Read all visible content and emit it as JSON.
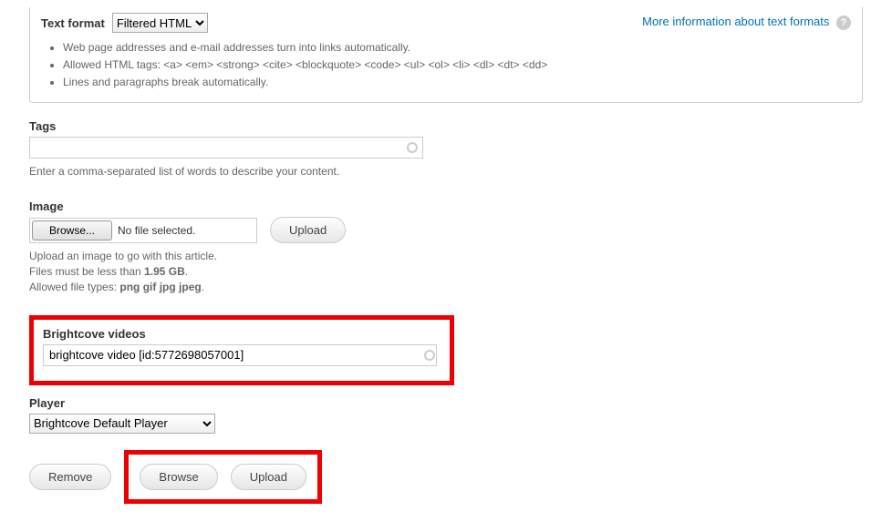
{
  "format": {
    "label": "Text format",
    "selected": "Filtered HTML",
    "more_info_label": "More information about text formats",
    "tips": [
      "Web page addresses and e-mail addresses turn into links automatically.",
      "Allowed HTML tags: <a> <em> <strong> <cite> <blockquote> <code> <ul> <ol> <li> <dl> <dt> <dd>",
      "Lines and paragraphs break automatically."
    ]
  },
  "tags": {
    "label": "Tags",
    "value": "",
    "description": "Enter a comma-separated list of words to describe your content."
  },
  "image": {
    "label": "Image",
    "browse_label": "Browse...",
    "no_file": "No file selected.",
    "upload_label": "Upload",
    "desc1": "Upload an image to go with this article.",
    "desc2a": "Files must be less than ",
    "desc2b": "1.95 GB",
    "desc2c": ".",
    "desc3a": "Allowed file types: ",
    "desc3b": "png gif jpg jpeg",
    "desc3c": "."
  },
  "brightcove": {
    "label": "Brightcove videos",
    "value": "brightcove video [id:5772698057001]"
  },
  "player": {
    "label": "Player",
    "selected": "Brightcove Default Player"
  },
  "buttons": {
    "remove": "Remove",
    "browse": "Browse",
    "upload": "Upload"
  }
}
